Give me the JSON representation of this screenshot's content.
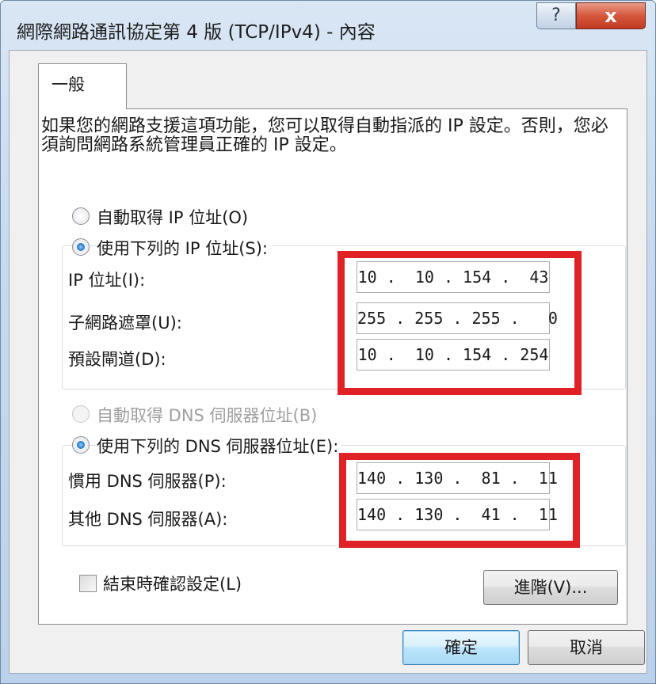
{
  "window": {
    "title": "網際網路通訊協定第 4 版 (TCP/IPv4) - 內容",
    "help_glyph": "?",
    "close_glyph": "x"
  },
  "tabs": [
    {
      "label": "一般"
    }
  ],
  "description": "如果您的網路支援這項功能，您可以取得自動指派的 IP 設定。否則，您必須詢問網路系統管理員正確的 IP 設定。",
  "ip_mode": {
    "auto_label": "自動取得 IP 位址(O)",
    "manual_label": "使用下列的 IP 位址(S):",
    "selected": "manual"
  },
  "ip_fields": [
    {
      "label": "IP 位址(I):",
      "value": "10 .  10 . 154 .  43"
    },
    {
      "label": "子網路遮罩(U):",
      "value": "255 . 255 . 255 .   0"
    },
    {
      "label": "預設閘道(D):",
      "value": "10 .  10 . 154 . 254"
    }
  ],
  "dns_mode": {
    "auto_label": "自動取得 DNS 伺服器位址(B)",
    "manual_label": "使用下列的 DNS 伺服器位址(E):",
    "selected": "manual",
    "auto_disabled": true
  },
  "dns_fields": [
    {
      "label": "慣用 DNS 伺服器(P):",
      "value": "140 . 130 .  81 .  11"
    },
    {
      "label": "其他 DNS 伺服器(A):",
      "value": "140 . 130 .  41 .  11"
    }
  ],
  "validate_on_exit": {
    "label": "結束時確認設定(L)",
    "checked": false
  },
  "buttons": {
    "advanced": "進階(V)...",
    "ok": "確定",
    "cancel": "取消"
  },
  "colors": {
    "highlight_box": "#e02227",
    "title_gradient_top": "#d9e6f4",
    "close_button": "#c23a22",
    "dialog_face": "#f0f0f0"
  }
}
